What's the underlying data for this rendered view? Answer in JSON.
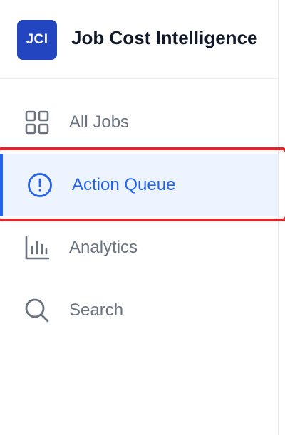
{
  "app": {
    "logo_text": "JCI",
    "title": "Job Cost Intelligence"
  },
  "nav": {
    "items": [
      {
        "label": "All Jobs",
        "icon": "grid-icon"
      },
      {
        "label": "Action Queue",
        "icon": "alert-circle-icon",
        "active": true
      },
      {
        "label": "Analytics",
        "icon": "bar-chart-icon"
      },
      {
        "label": "Search",
        "icon": "search-icon"
      }
    ]
  },
  "colors": {
    "brand": "#2445c0",
    "active_accent": "#2563eb",
    "active_bg": "#eef4ff",
    "muted_text": "#6b7280",
    "highlight": "#e0262b"
  }
}
